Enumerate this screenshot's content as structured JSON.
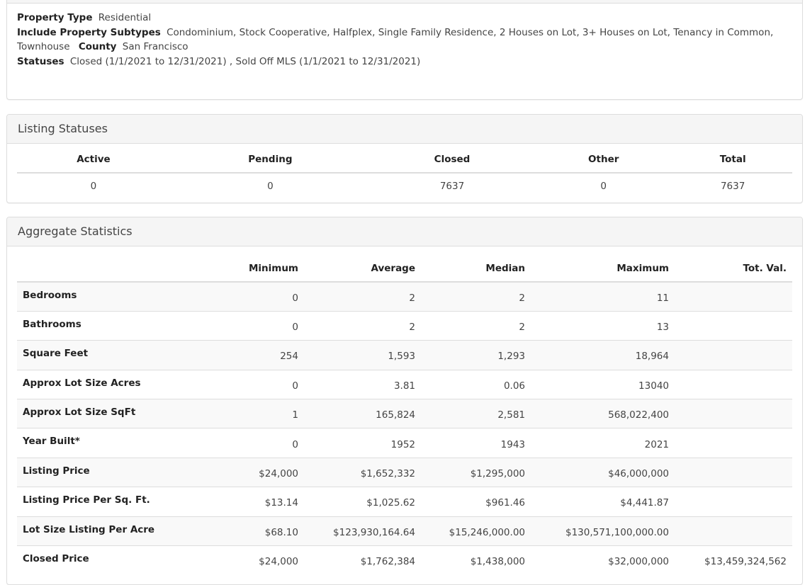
{
  "criteria": {
    "property_type_label": "Property Type",
    "property_type_value": "Residential",
    "subtypes_label": "Include Property Subtypes",
    "subtypes_value": "Condominium, Stock Cooperative, Halfplex, Single Family Residence, 2 Houses on Lot, 3+ Houses on Lot, Tenancy in Common, Townhouse",
    "county_label": "County",
    "county_value": "San Francisco",
    "statuses_label": "Statuses",
    "statuses_value": "Closed (1/1/2021 to 12/31/2021) , Sold Off MLS (1/1/2021 to 12/31/2021)"
  },
  "listing_statuses": {
    "title": "Listing Statuses",
    "headers": [
      "Active",
      "Pending",
      "Closed",
      "Other",
      "Total"
    ],
    "values": [
      "0",
      "0",
      "7637",
      "0",
      "7637"
    ]
  },
  "aggregate": {
    "title": "Aggregate Statistics",
    "headers": [
      "",
      "Minimum",
      "Average",
      "Median",
      "Maximum",
      "Tot. Val."
    ],
    "rows": [
      {
        "label": "Bedrooms",
        "min": "0",
        "avg": "2",
        "median": "2",
        "max": "11",
        "total": ""
      },
      {
        "label": "Bathrooms",
        "min": "0",
        "avg": "2",
        "median": "2",
        "max": "13",
        "total": ""
      },
      {
        "label": "Square Feet",
        "min": "254",
        "avg": "1,593",
        "median": "1,293",
        "max": "18,964",
        "total": ""
      },
      {
        "label": "Approx Lot Size Acres",
        "min": "0",
        "avg": "3.81",
        "median": "0.06",
        "max": "13040",
        "total": ""
      },
      {
        "label": "Approx Lot Size SqFt",
        "min": "1",
        "avg": "165,824",
        "median": "2,581",
        "max": "568,022,400",
        "total": ""
      },
      {
        "label": "Year Built*",
        "min": "0",
        "avg": "1952",
        "median": "1943",
        "max": "2021",
        "total": ""
      },
      {
        "label": "Listing Price",
        "min": "$24,000",
        "avg": "$1,652,332",
        "median": "$1,295,000",
        "max": "$46,000,000",
        "total": ""
      },
      {
        "label": "Listing Price Per Sq. Ft.",
        "min": "$13.14",
        "avg": "$1,025.62",
        "median": "$961.46",
        "max": "$4,441.87",
        "total": ""
      },
      {
        "label": "Lot Size Listing Per Acre",
        "min": "$68.10",
        "avg": "$123,930,164.64",
        "median": "$15,246,000.00",
        "max": "$130,571,100,000.00",
        "total": ""
      },
      {
        "label": "Closed Price",
        "min": "$24,000",
        "avg": "$1,762,384",
        "median": "$1,438,000",
        "max": "$32,000,000",
        "total": "$13,459,324,562"
      }
    ]
  }
}
